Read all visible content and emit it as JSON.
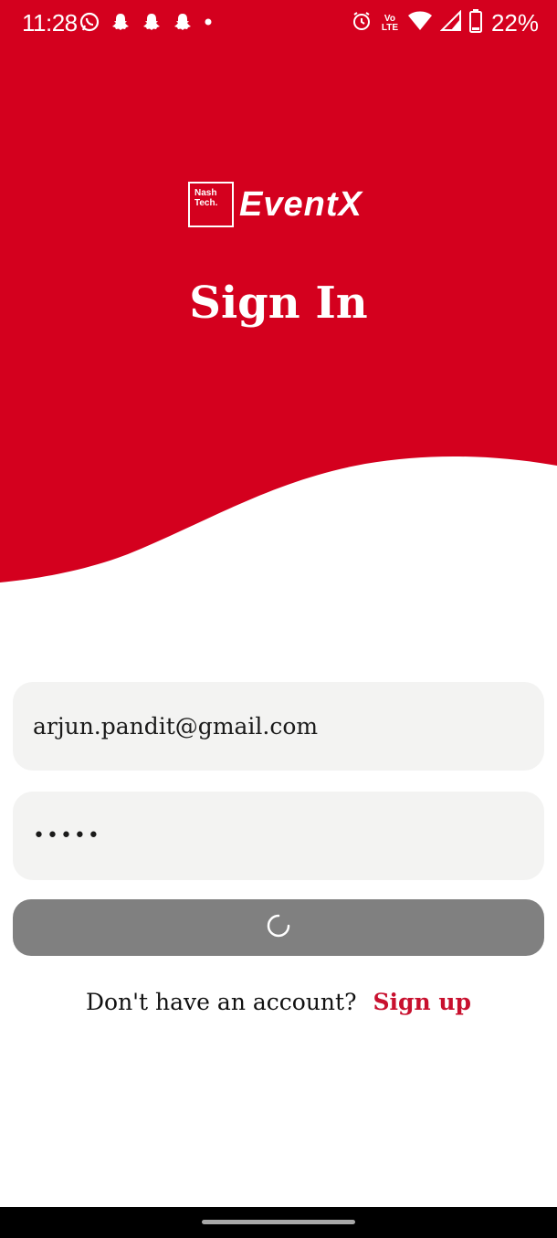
{
  "colors": {
    "brand_red": "#D4001E",
    "link_red": "#C8102E",
    "field_bg": "#F3F3F2",
    "button_disabled": "#808080"
  },
  "status_bar": {
    "time": "11:28",
    "battery": "22%",
    "network_label_top": "Vo",
    "network_label_bottom": "LTE",
    "left_icons": [
      "whatsapp-icon",
      "snapchat-icon",
      "snapchat-icon",
      "snapchat-icon",
      "dot-icon"
    ],
    "right_icons": [
      "alarm-icon",
      "volte-icon",
      "wifi-icon",
      "signal-icon",
      "battery-icon"
    ]
  },
  "logo": {
    "box_line1": "Nash",
    "box_line2": "Tech.",
    "name": "EventX"
  },
  "page_title": "Sign In",
  "form": {
    "email_value": "arjun.pandit@gmail.com",
    "password_value": "•••••",
    "submit_state": "loading",
    "submit_icon": "spinner-icon"
  },
  "signup": {
    "prompt": "Don't have an account?",
    "link": "Sign up"
  }
}
